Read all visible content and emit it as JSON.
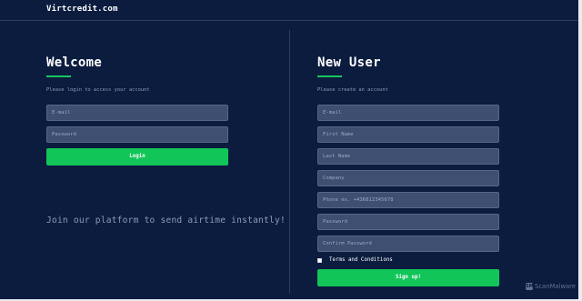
{
  "header": {
    "brand": "Virtcredit.com"
  },
  "login": {
    "title": "Welcome",
    "subtitle": "Please login to access your account",
    "email_placeholder": "E-mail",
    "password_placeholder": "Password",
    "button_label": "Login"
  },
  "tagline": "Join our platform to send airtime instantly!",
  "signup": {
    "title": "New User",
    "subtitle": "Please create an account",
    "email_placeholder": "E-mail",
    "first_name_placeholder": "First Name",
    "last_name_placeholder": "Last Name",
    "company_placeholder": "Company",
    "phone_placeholder": "Phone ex. +436812345678",
    "password_placeholder": "Password",
    "confirm_password_placeholder": "Confirm Password",
    "terms_label": "Terms and Conditions",
    "terms_checked": false,
    "button_label": "Sign up!"
  },
  "watermark": {
    "text": "ScanMalware",
    "badge": "SM"
  },
  "colors": {
    "background": "#0b1c3f",
    "accent": "#19c55e",
    "button": "#12c558",
    "field": "#3e4f72",
    "muted_text": "#8d9bb6"
  }
}
